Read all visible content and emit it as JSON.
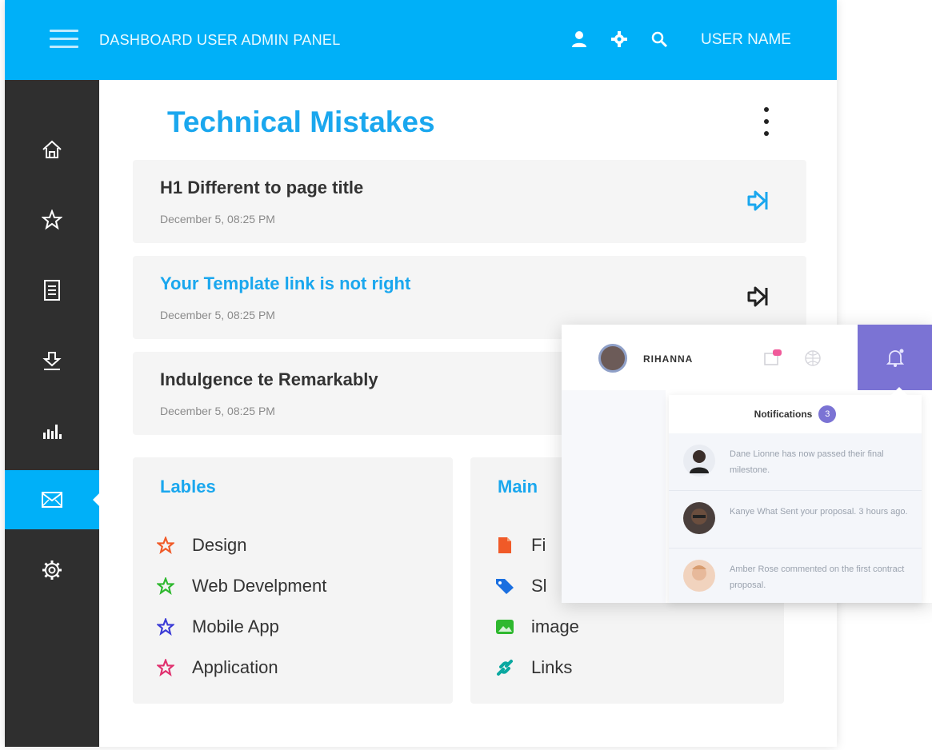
{
  "header": {
    "title": "DASHBOARD USER ADMIN PANEL",
    "username": "USER NAME",
    "icons": [
      "user-icon",
      "gear-icon",
      "search-icon"
    ]
  },
  "sidebar": {
    "items": [
      {
        "icon": "home-icon"
      },
      {
        "icon": "star-icon"
      },
      {
        "icon": "document-icon"
      },
      {
        "icon": "download-icon"
      },
      {
        "icon": "chart-icon"
      },
      {
        "icon": "mail-icon",
        "active": true
      },
      {
        "icon": "settings-icon"
      }
    ]
  },
  "main": {
    "title": "Technical Mistakes",
    "issues": [
      {
        "title": "H1 Different to page title",
        "date": "December 5, 08:25 PM"
      },
      {
        "title": "Your Template link is not right",
        "date": "December 5, 08:25 PM"
      },
      {
        "title": "Indulgence te Remarkably",
        "date": "December 5, 08:25 PM"
      }
    ]
  },
  "labels_card": {
    "heading": "Lables",
    "items": [
      {
        "label": "Design",
        "color": "#f05a28"
      },
      {
        "label": "Web Develpment",
        "color": "#2eb82e"
      },
      {
        "label": "Mobile App",
        "color": "#3b3bd6"
      },
      {
        "label": "Application",
        "color": "#e0306e"
      }
    ]
  },
  "main_card": {
    "heading": "Main",
    "items": [
      {
        "label": "Fi",
        "icon": "file-icon",
        "color": "#f05a28"
      },
      {
        "label": "Sl",
        "icon": "tag-icon",
        "color": "#1a6fe0"
      },
      {
        "label": "image",
        "icon": "image-icon",
        "color": "#2eb82e"
      },
      {
        "label": "Links",
        "icon": "link-icon",
        "color": "#0aa8a0"
      }
    ]
  },
  "popup": {
    "name": "RIHANNA",
    "notifications_title": "Notifications",
    "notifications_count": "3",
    "accent": "#7b73d4",
    "items": [
      {
        "text": "Dane Lionne has now passed their final milestone."
      },
      {
        "text": "Kanye What Sent your proposal. 3 hours ago."
      },
      {
        "text": "Amber Rose commented on the first contract proposal."
      }
    ]
  },
  "colors": {
    "primary": "#00b0f8",
    "sidebar": "#2f2f2f",
    "title_blue": "#1aa7ee"
  }
}
